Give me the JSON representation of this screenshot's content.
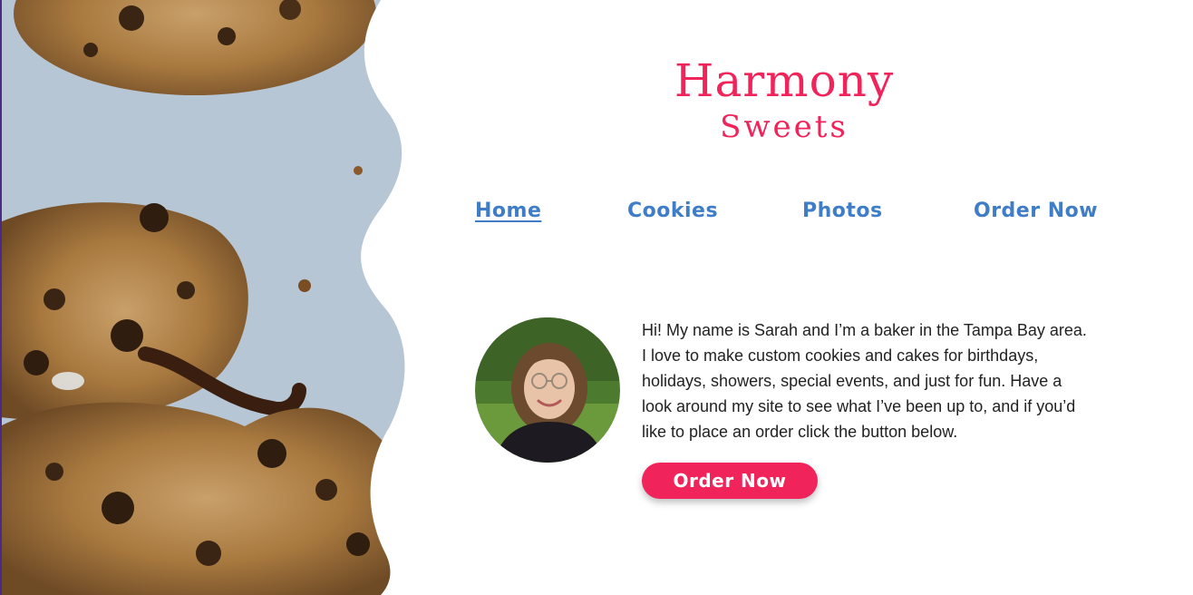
{
  "brand": {
    "line1": "Harmony",
    "line2": "Sweets",
    "color": "#f0245a"
  },
  "nav": {
    "items": [
      {
        "label": "Home",
        "active": true
      },
      {
        "label": "Cookies",
        "active": false
      },
      {
        "label": "Photos",
        "active": false
      },
      {
        "label": "Order Now",
        "active": false
      }
    ],
    "color": "#3f7dc6"
  },
  "intro": {
    "text": "Hi! My name is Sarah and I’m a baker in the Tampa Bay area. I love to make custom cookies and cakes for birthdays, holidays, showers, special events, and just for fun. Have a look around my site to see what I’ve been up to, and if you’d like to place an order click the button below.",
    "button_label": "Order Now",
    "button_color": "#f0245a"
  },
  "images": {
    "hero": "cookies-photo",
    "avatar": "baker-portrait"
  }
}
